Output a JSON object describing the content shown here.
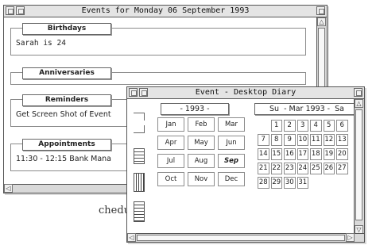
{
  "background": {
    "partial_text": "chedule."
  },
  "events_window": {
    "title": "Events for Monday 06 September 1993",
    "sections": [
      {
        "label": "Birthdays",
        "value": "Sarah is 24"
      },
      {
        "label": "Anniversaries",
        "value": ""
      },
      {
        "label": "Reminders",
        "value": "Get Screen Shot of Event"
      },
      {
        "label": "Appointments",
        "value": "11:30 - 12:15 Bank Mana"
      }
    ]
  },
  "diary_window": {
    "title": "Event - Desktop Diary",
    "year_label": "- 1993 -",
    "months": [
      "Jan",
      "Feb",
      "Mar",
      "Apr",
      "May",
      "Jun",
      "Jul",
      "Aug",
      "Sep",
      "Oct",
      "Nov",
      "Dec"
    ],
    "selected_month": "Sep",
    "calendar_header": "Su  - Mar 1993 -  Sa",
    "days": [
      "1",
      "2",
      "3",
      "4",
      "5",
      "6",
      "7",
      "8",
      "9",
      "10",
      "11",
      "12",
      "13",
      "14",
      "15",
      "16",
      "17",
      "18",
      "19",
      "20",
      "21",
      "22",
      "23",
      "24",
      "25",
      "26",
      "27",
      "28",
      "29",
      "30",
      "31"
    ]
  },
  "colors": {
    "chrome": "#e4e4e4",
    "border": "#555555",
    "scroll": "#d9d9d9"
  },
  "icons": [
    "close-icon",
    "iconise-icon",
    "toggle-size-icon",
    "scroll-up-icon",
    "scroll-down-icon",
    "scroll-left-icon",
    "scroll-right-icon",
    "enter-icon",
    "return-icon",
    "list-icon",
    "bars-icon",
    "grid-icon"
  ]
}
